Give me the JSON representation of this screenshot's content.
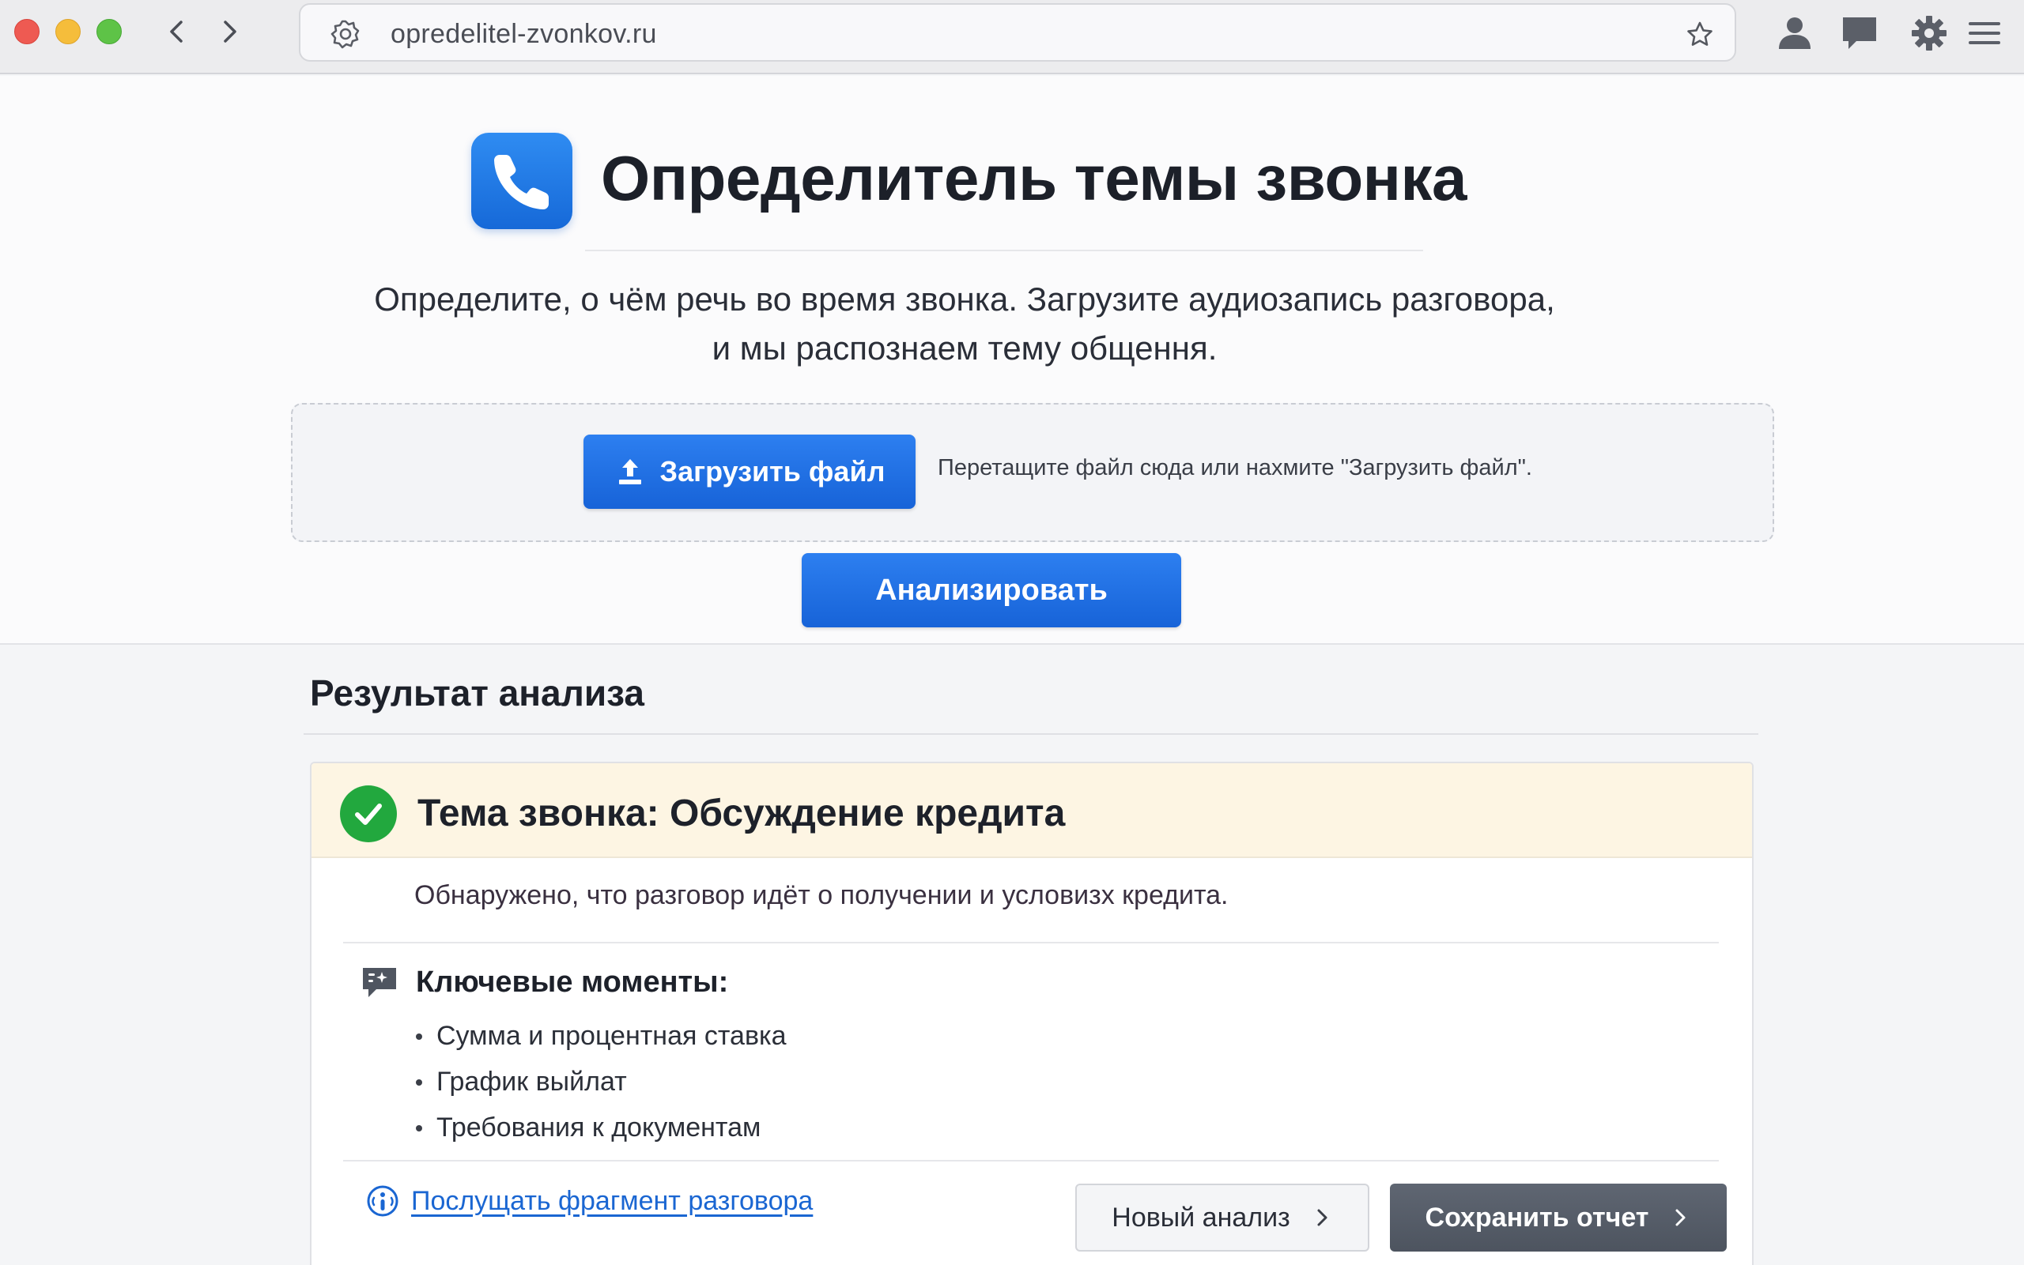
{
  "browser": {
    "url": "opredelitel-zvonkov.ru"
  },
  "header": {
    "title": "Определитель темы звонка",
    "subtitle_line1": "Определите, о чём речь во время звонка. Загрузите аудиозапись разговора,",
    "subtitle_line2": "и мы распознаем тему общення."
  },
  "upload": {
    "button_label": "Загрузить файл",
    "hint": "Перетащите файл сюда или нахмите \"Загрузить файл\"."
  },
  "analyze": {
    "button_label": "Анализировать"
  },
  "result": {
    "section_title": "Результат анализа",
    "topic_title": "Тема звонка: Обсуждение кредита",
    "description": "Обнаружено, что разговор идёт о получении и условизх кредита.",
    "key_points_title": "Ключевые моменты:",
    "key_points": [
      "Сумма и процентная ставка",
      "График выйлат",
      "Требования к документам"
    ],
    "listen_link": "Послущать фрагмент разговора",
    "new_analysis_label": "Новый анализ",
    "save_report_label": "Сохранить отчет"
  },
  "colors": {
    "accent": "#1a6ee0",
    "success": "#22a83e",
    "highlight_bg": "#fdf5e3",
    "dark_button": "#565d68"
  }
}
